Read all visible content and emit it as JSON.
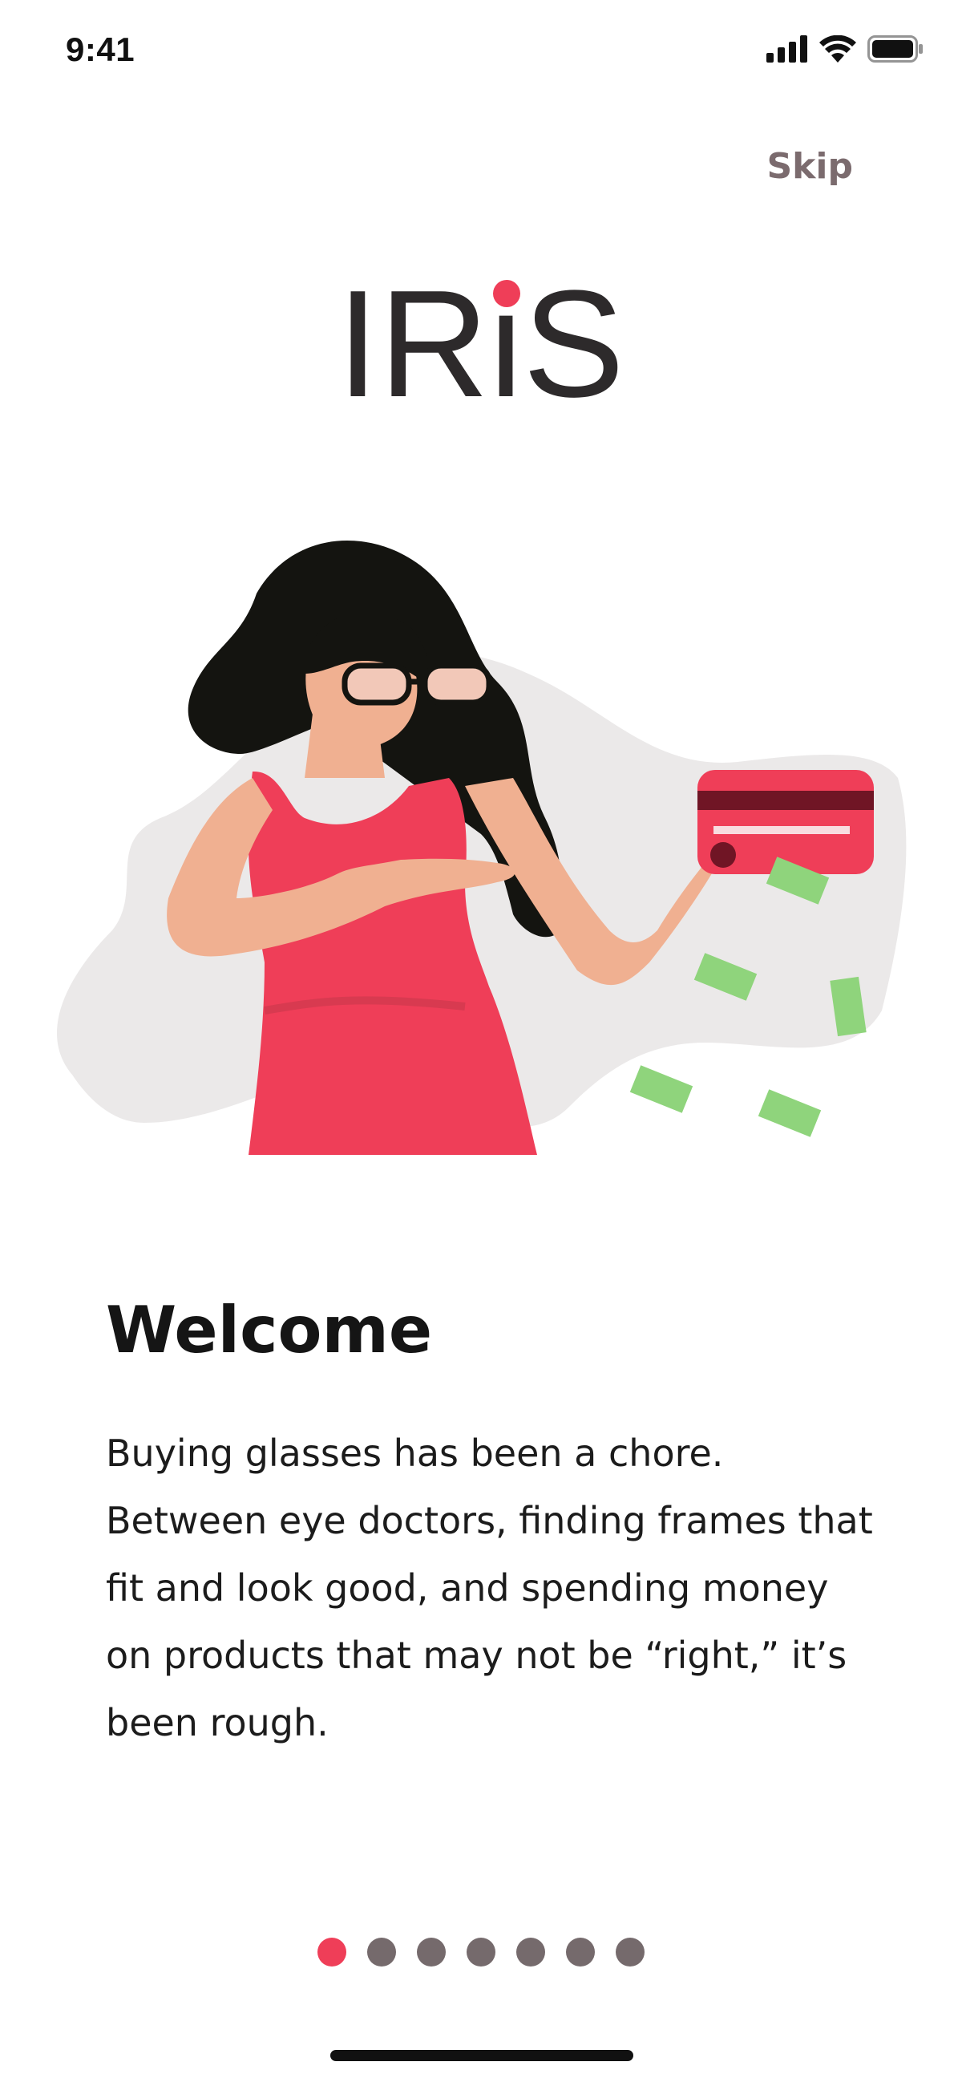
{
  "status_bar": {
    "time": "9:41",
    "icons": [
      "cellular-signal-icon",
      "wifi-icon",
      "battery-icon"
    ]
  },
  "skip_label": "Skip",
  "logo": {
    "text_part1": "IR",
    "text_i": "i",
    "text_part2": "S",
    "dot_color": "#ef3e58",
    "text_color": "#2d2a2b"
  },
  "illustration": {
    "name": "woman-with-credit-card-illustration"
  },
  "onboarding": {
    "title": "Welcome",
    "body": "Buying glasses has been a chore. Between eye doctors, finding frames that fit and look good, and spending money on products that may not be “right,” it’s been rough."
  },
  "pagination": {
    "total": 7,
    "active_index": 0,
    "active_color": "#ef3e58",
    "inactive_color": "#756a6c"
  },
  "colors": {
    "accent": "#ef3e58",
    "muted": "#7b6b6e"
  }
}
